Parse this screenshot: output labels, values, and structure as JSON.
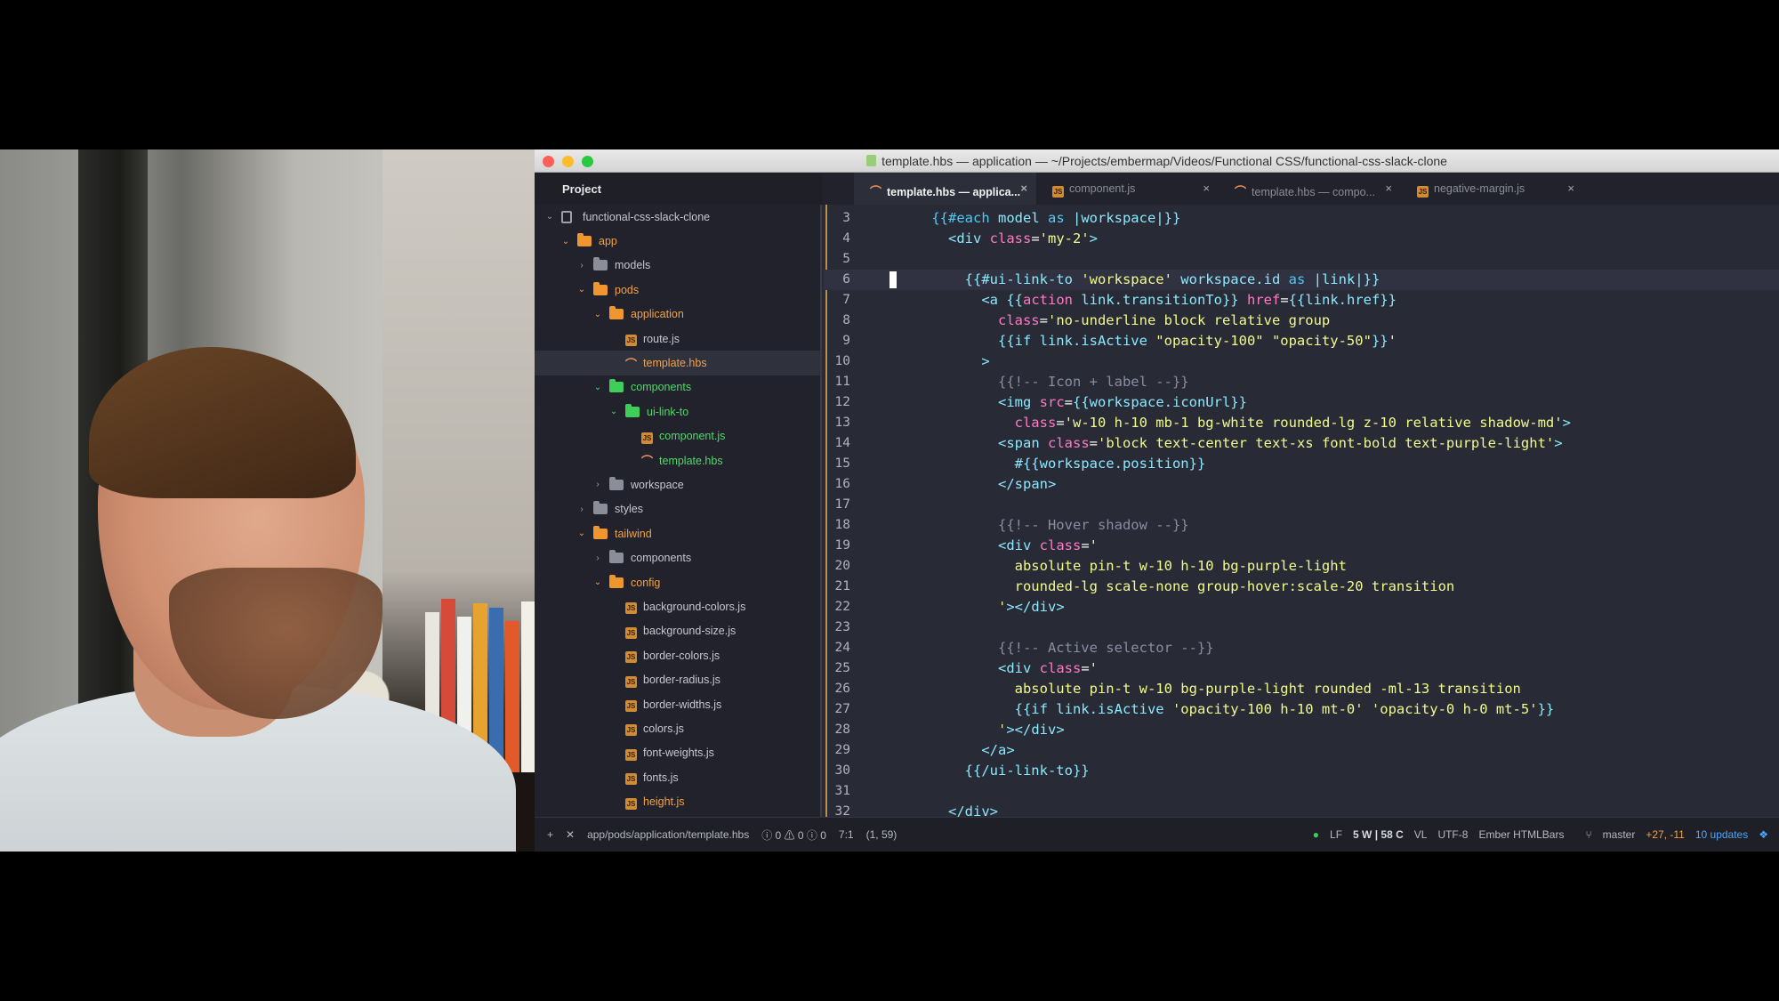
{
  "window": {
    "title": "template.hbs — application — ~/Projects/embermap/Videos/Functional CSS/functional-css-slack-clone"
  },
  "tree": {
    "header": "Project",
    "items": [
      {
        "label": "functional-css-slack-clone",
        "kind": "repo",
        "depth": 0
      },
      {
        "label": "app",
        "kind": "folder-open-orange",
        "depth": 1
      },
      {
        "label": "models",
        "kind": "folder-closed",
        "depth": 2
      },
      {
        "label": "pods",
        "kind": "folder-open-orange",
        "depth": 2
      },
      {
        "label": "application",
        "kind": "folder-open-orange",
        "depth": 3
      },
      {
        "label": "route.js",
        "kind": "js",
        "depth": 4
      },
      {
        "label": "template.hbs",
        "kind": "hbs-orange",
        "depth": 4
      },
      {
        "label": "components",
        "kind": "folder-open-green",
        "depth": 3
      },
      {
        "label": "ui-link-to",
        "kind": "folder-open-green",
        "depth": 4
      },
      {
        "label": "component.js",
        "kind": "js-green",
        "depth": 5
      },
      {
        "label": "template.hbs",
        "kind": "hbs-green",
        "depth": 5
      },
      {
        "label": "workspace",
        "kind": "folder-closed",
        "depth": 3
      },
      {
        "label": "styles",
        "kind": "folder-closed",
        "depth": 2
      },
      {
        "label": "tailwind",
        "kind": "folder-open-orange",
        "depth": 2
      },
      {
        "label": "components",
        "kind": "folder-closed",
        "depth": 3
      },
      {
        "label": "config",
        "kind": "folder-open-orange",
        "depth": 3
      },
      {
        "label": "background-colors.js",
        "kind": "js",
        "depth": 4
      },
      {
        "label": "background-size.js",
        "kind": "js",
        "depth": 4
      },
      {
        "label": "border-colors.js",
        "kind": "js",
        "depth": 4
      },
      {
        "label": "border-radius.js",
        "kind": "js",
        "depth": 4
      },
      {
        "label": "border-widths.js",
        "kind": "js",
        "depth": 4
      },
      {
        "label": "colors.js",
        "kind": "js",
        "depth": 4
      },
      {
        "label": "font-weights.js",
        "kind": "js",
        "depth": 4
      },
      {
        "label": "fonts.js",
        "kind": "js",
        "depth": 4
      },
      {
        "label": "height.js",
        "kind": "js-orange",
        "depth": 4
      }
    ]
  },
  "tabs": [
    {
      "label": "template.hbs — applica...",
      "icon": "hbs",
      "active": true
    },
    {
      "label": "component.js",
      "icon": "js",
      "active": false
    },
    {
      "label": "template.hbs — compo...",
      "icon": "hbs",
      "active": false
    },
    {
      "label": "negative-margin.js",
      "icon": "js",
      "active": false
    }
  ],
  "editor": {
    "cursor_line": "6",
    "lines": [
      {
        "n": "3",
        "tokens": [
          [
            "    ",
            "pl"
          ],
          [
            "{{#each",
            "kw"
          ],
          [
            " model ",
            "op"
          ],
          [
            "as",
            "kw"
          ],
          [
            " |workspace|}}",
            "op"
          ]
        ]
      },
      {
        "n": "4",
        "tokens": [
          [
            "      <",
            "tag"
          ],
          [
            "div",
            "tag"
          ],
          [
            " class",
            "attr"
          ],
          [
            "=",
            "pl"
          ],
          [
            "'my-2'",
            "str"
          ],
          [
            ">",
            "tag"
          ]
        ]
      },
      {
        "n": "5",
        "tokens": [
          [
            "",
            "pl"
          ]
        ]
      },
      {
        "n": "6",
        "tokens": [
          [
            "        {{#ui-link-to ",
            "op"
          ],
          [
            "'workspace'",
            "str"
          ],
          [
            " workspace.id ",
            "op"
          ],
          [
            "as",
            "kw"
          ],
          [
            " |link|}}",
            "op"
          ]
        ]
      },
      {
        "n": "7",
        "tokens": [
          [
            "          <",
            "tag"
          ],
          [
            "a",
            "tag"
          ],
          [
            " {{",
            "op"
          ],
          [
            "action",
            "attr"
          ],
          [
            " link.transitionTo}}",
            "op"
          ],
          [
            " href",
            "attr"
          ],
          [
            "=",
            "pl"
          ],
          [
            "{{link.href}}",
            "op"
          ]
        ]
      },
      {
        "n": "8",
        "tokens": [
          [
            "            class",
            "attr"
          ],
          [
            "=",
            "pl"
          ],
          [
            "'no-underline block relative group",
            "str"
          ]
        ]
      },
      {
        "n": "9",
        "tokens": [
          [
            "            {{if link.isActive ",
            "op"
          ],
          [
            "\"opacity-100\" \"opacity-50\"",
            "str"
          ],
          [
            "}}",
            "op"
          ],
          [
            "'",
            "str"
          ]
        ]
      },
      {
        "n": "10",
        "tokens": [
          [
            "          >",
            "tag"
          ]
        ]
      },
      {
        "n": "11",
        "tokens": [
          [
            "            {{!-- Icon + label --}}",
            "cmt"
          ]
        ]
      },
      {
        "n": "12",
        "tokens": [
          [
            "            <",
            "tag"
          ],
          [
            "img",
            "tag"
          ],
          [
            " src",
            "attr"
          ],
          [
            "=",
            "pl"
          ],
          [
            "{{workspace.iconUrl}}",
            "op"
          ]
        ]
      },
      {
        "n": "13",
        "tokens": [
          [
            "              class",
            "attr"
          ],
          [
            "=",
            "pl"
          ],
          [
            "'w-10 h-10 mb-1 bg-white rounded-lg z-10 relative shadow-md'",
            "str"
          ],
          [
            ">",
            "tag"
          ]
        ]
      },
      {
        "n": "14",
        "tokens": [
          [
            "            <",
            "tag"
          ],
          [
            "span",
            "tag"
          ],
          [
            " class",
            "attr"
          ],
          [
            "=",
            "pl"
          ],
          [
            "'block text-center text-xs font-bold text-purple-light'",
            "str"
          ],
          [
            ">",
            "tag"
          ]
        ]
      },
      {
        "n": "15",
        "tokens": [
          [
            "              #{{workspace.position}}",
            "op"
          ]
        ]
      },
      {
        "n": "16",
        "tokens": [
          [
            "            </",
            "tag"
          ],
          [
            "span",
            "tag"
          ],
          [
            ">",
            "tag"
          ]
        ]
      },
      {
        "n": "17",
        "tokens": [
          [
            "",
            "pl"
          ]
        ]
      },
      {
        "n": "18",
        "tokens": [
          [
            "            {{!-- Hover shadow --}}",
            "cmt"
          ]
        ]
      },
      {
        "n": "19",
        "tokens": [
          [
            "            <",
            "tag"
          ],
          [
            "div",
            "tag"
          ],
          [
            " class",
            "attr"
          ],
          [
            "=",
            "pl"
          ],
          [
            "'",
            "str"
          ]
        ]
      },
      {
        "n": "20",
        "tokens": [
          [
            "              absolute pin-t w-10 h-10 bg-purple-light",
            "str"
          ]
        ]
      },
      {
        "n": "21",
        "tokens": [
          [
            "              rounded-lg scale-none group-hover:scale-20 transition",
            "str"
          ]
        ]
      },
      {
        "n": "22",
        "tokens": [
          [
            "            '",
            "str"
          ],
          [
            "></",
            "tag"
          ],
          [
            "div",
            "tag"
          ],
          [
            ">",
            "tag"
          ]
        ]
      },
      {
        "n": "23",
        "tokens": [
          [
            "",
            "pl"
          ]
        ]
      },
      {
        "n": "24",
        "tokens": [
          [
            "            {{!-- Active selector --}}",
            "cmt"
          ]
        ]
      },
      {
        "n": "25",
        "tokens": [
          [
            "            <",
            "tag"
          ],
          [
            "div",
            "tag"
          ],
          [
            " class",
            "attr"
          ],
          [
            "=",
            "pl"
          ],
          [
            "'",
            "str"
          ]
        ]
      },
      {
        "n": "26",
        "tokens": [
          [
            "              absolute pin-t w-10 bg-purple-light rounded -ml-13 transition",
            "str"
          ]
        ]
      },
      {
        "n": "27",
        "tokens": [
          [
            "              {{if link.isActive ",
            "op"
          ],
          [
            "'opacity-100 h-10 mt-0' 'opacity-0 h-0 mt-5'",
            "str"
          ],
          [
            "}}",
            "op"
          ]
        ]
      },
      {
        "n": "28",
        "tokens": [
          [
            "            '",
            "str"
          ],
          [
            "></",
            "tag"
          ],
          [
            "div",
            "tag"
          ],
          [
            ">",
            "tag"
          ]
        ]
      },
      {
        "n": "29",
        "tokens": [
          [
            "          </",
            "tag"
          ],
          [
            "a",
            "tag"
          ],
          [
            ">",
            "tag"
          ]
        ]
      },
      {
        "n": "30",
        "tokens": [
          [
            "        {{/ui-link-to}}",
            "op"
          ]
        ]
      },
      {
        "n": "31",
        "tokens": [
          [
            "",
            "pl"
          ]
        ]
      },
      {
        "n": "32",
        "tokens": [
          [
            "      </",
            "tag"
          ],
          [
            "div",
            "tag"
          ],
          [
            ">",
            "tag"
          ]
        ]
      }
    ]
  },
  "statusbar": {
    "add_symbol": "+",
    "close_symbol": "✕",
    "path": "app/pods/application/template.hbs",
    "diagnostics": "ⓘ 0 ⚠ 0 ⓘ 0",
    "cursor_pos": "7:1",
    "selection": "(1, 59)",
    "dot": "●",
    "line_ending": "LF",
    "word_count": "5 W | 58 C",
    "vl": "VL",
    "encoding": "UTF-8",
    "grammar": "Ember HTMLBars",
    "branch": "master",
    "git_diff": "+27, -11",
    "updates": "10 updates"
  },
  "colors": {
    "editor_bg": "#282a36",
    "tree_bg": "#21222c",
    "accent_orange": "#f0962e",
    "accent_green": "#3ecf5a"
  }
}
